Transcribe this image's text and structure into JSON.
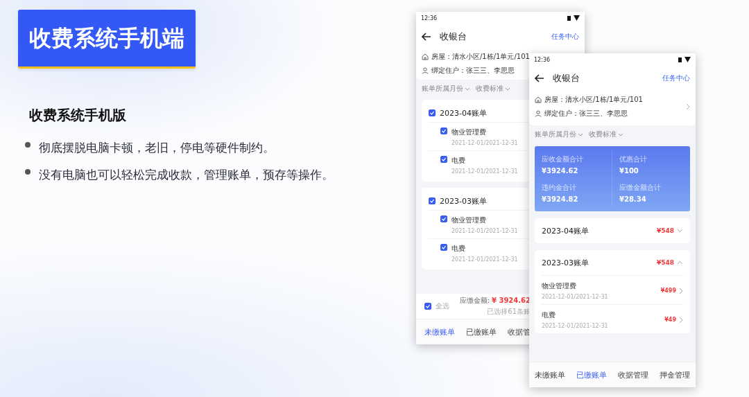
{
  "slide_title": "收费系统手机端",
  "heading": "收费系统手机版",
  "bullets": [
    "彻底摆脱电脑卡顿，老旧，停电等硬件制约。",
    "没有电脑也可以轻松完成收款，管理账单，预存等操作。"
  ],
  "phone_back": {
    "time": "12:36",
    "title": "收银台",
    "header_link": "任务中心",
    "house": "房屋：清水小区/1栋/1单元/101",
    "resident": "绑定住户：张三三、李思思",
    "filters": [
      "账单所属月份",
      "收费标准"
    ],
    "bills": [
      {
        "title": "2023-04账单",
        "checked": true,
        "items": [
          {
            "name": "物业管理费",
            "period": "2021-12-01/2021-12-31",
            "checked": true
          },
          {
            "name": "电费",
            "period": "2021-12-01/2021-12-31",
            "checked": true
          }
        ]
      },
      {
        "title": "2023-03账单",
        "checked": true,
        "items": [
          {
            "name": "物业管理费",
            "period": "2021-12-01/2021-12-31",
            "checked": true
          },
          {
            "name": "电费",
            "period": "2021-12-01/2021-12-31",
            "checked": true
          }
        ]
      }
    ],
    "select_all": {
      "label": "全选",
      "checked": true
    },
    "due_label": "应缴金额:",
    "due_amount": "¥ 3924.62",
    "selected_count": "已选择61条账",
    "tabs": [
      {
        "label": "未缴账单",
        "selected": true
      },
      {
        "label": "已缴账单",
        "selected": false
      },
      {
        "label": "收据管",
        "selected": false
      }
    ]
  },
  "phone_front": {
    "time": "12:36",
    "title": "收银台",
    "header_link": "任务中心",
    "house": "房屋：清水小区/1栋/1单元/101",
    "resident": "绑定住户：张三三、李思思",
    "filters": [
      "账单所属月份",
      "收费标准"
    ],
    "summary": [
      {
        "label": "应收金额合计",
        "value": "¥3924.62"
      },
      {
        "label": "优惠合计",
        "value": "¥100"
      },
      {
        "label": "违约金合计",
        "value": "¥3924.82"
      },
      {
        "label": "应缴金额合计",
        "value": "¥28.34"
      }
    ],
    "bills": [
      {
        "title": "2023-04账单",
        "amount": "¥548",
        "expanded": false
      },
      {
        "title": "2023-03账单",
        "amount": "¥548",
        "expanded": true,
        "items": [
          {
            "name": "物业管理费",
            "period": "2021-12-01/2021-12-31",
            "amount": "¥499"
          },
          {
            "name": "电费",
            "period": "2021-12-01/2021-12-31",
            "amount": "¥49"
          }
        ]
      }
    ],
    "tabs": [
      {
        "label": "未缴账单",
        "selected": false
      },
      {
        "label": "已缴账单",
        "selected": true
      },
      {
        "label": "收据管理",
        "selected": false
      },
      {
        "label": "押金管理",
        "selected": false
      }
    ]
  }
}
